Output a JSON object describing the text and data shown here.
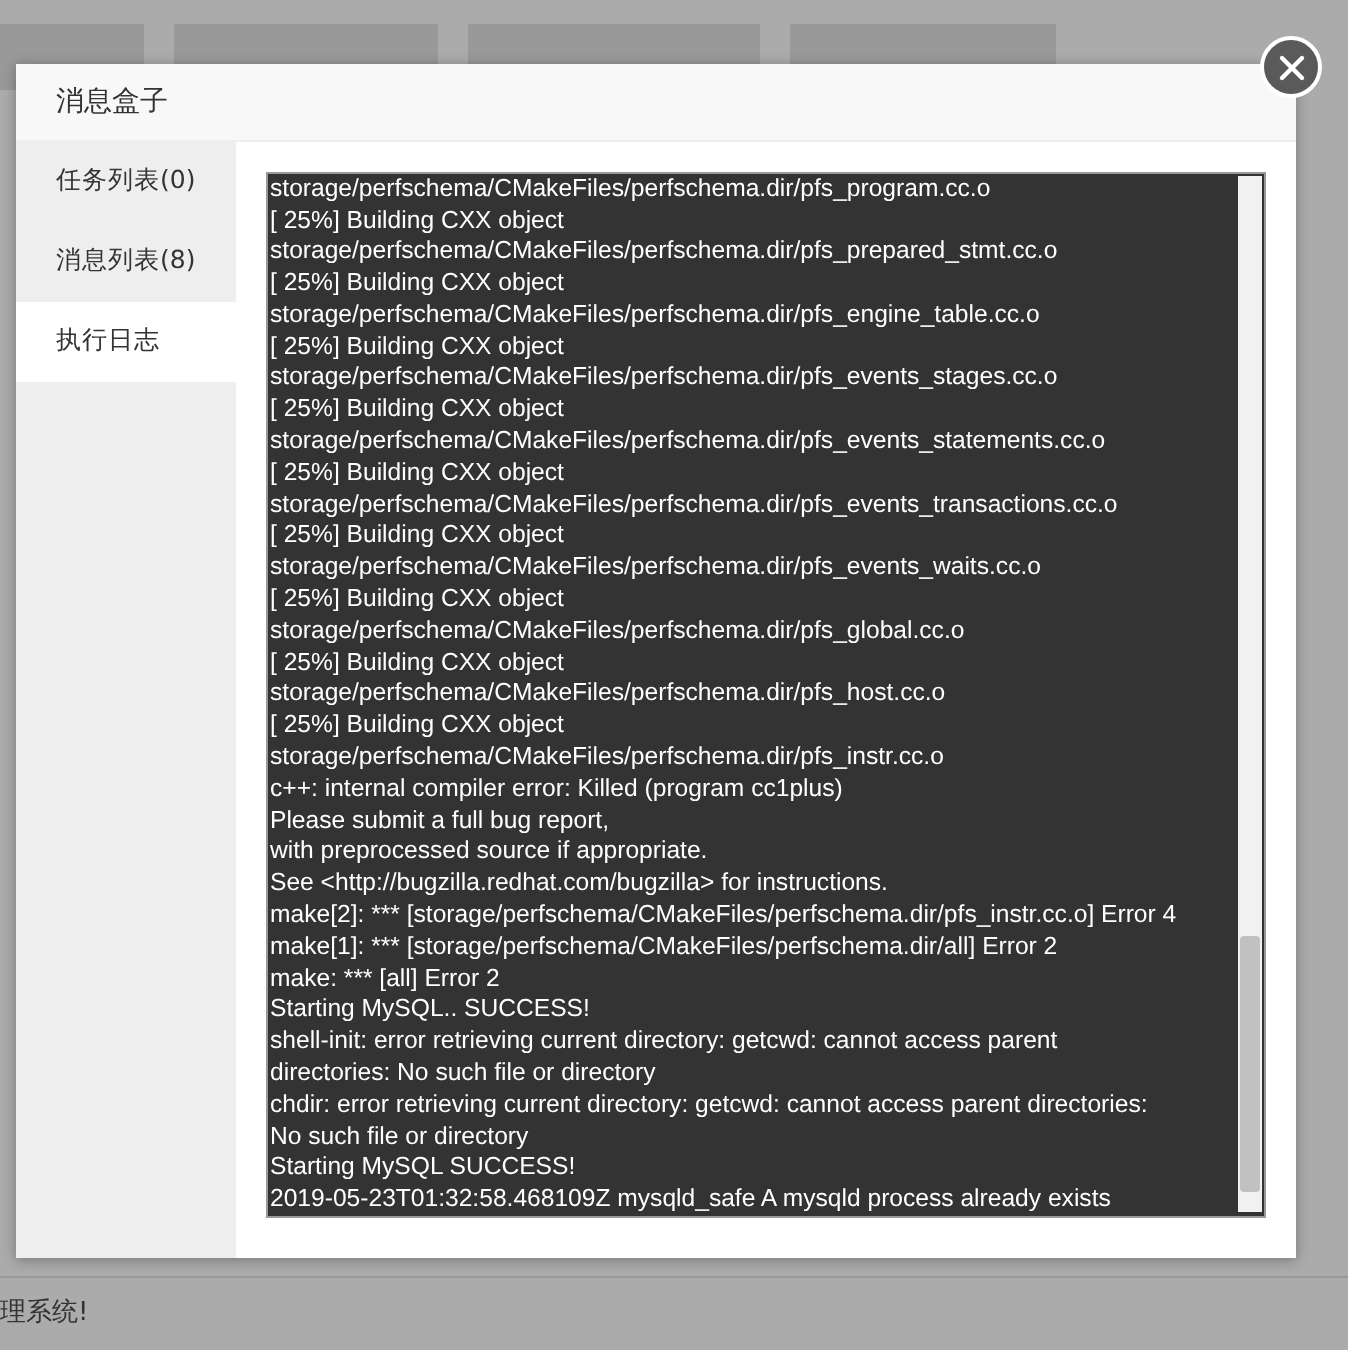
{
  "background_page": {
    "footer_text": "理系统!"
  },
  "dialog": {
    "title": "消息盒子",
    "menu": [
      {
        "label": "任务列表(0)",
        "selected": false
      },
      {
        "label": "消息列表(8)",
        "selected": false
      },
      {
        "label": "执行日志",
        "selected": true
      }
    ],
    "log_lines": [
      "storage/perfschema/CMakeFiles/perfschema.dir/pfs_program.cc.o",
      "[ 25%] Building CXX object",
      "storage/perfschema/CMakeFiles/perfschema.dir/pfs_prepared_stmt.cc.o",
      "[ 25%] Building CXX object",
      "storage/perfschema/CMakeFiles/perfschema.dir/pfs_engine_table.cc.o",
      "[ 25%] Building CXX object",
      "storage/perfschema/CMakeFiles/perfschema.dir/pfs_events_stages.cc.o",
      "[ 25%] Building CXX object",
      "storage/perfschema/CMakeFiles/perfschema.dir/pfs_events_statements.cc.o",
      "[ 25%] Building CXX object",
      "storage/perfschema/CMakeFiles/perfschema.dir/pfs_events_transactions.cc.o",
      "[ 25%] Building CXX object",
      "storage/perfschema/CMakeFiles/perfschema.dir/pfs_events_waits.cc.o",
      "[ 25%] Building CXX object",
      "storage/perfschema/CMakeFiles/perfschema.dir/pfs_global.cc.o",
      "[ 25%] Building CXX object",
      "storage/perfschema/CMakeFiles/perfschema.dir/pfs_host.cc.o",
      "[ 25%] Building CXX object",
      "storage/perfschema/CMakeFiles/perfschema.dir/pfs_instr.cc.o",
      "c++: internal compiler error: Killed (program cc1plus)",
      "Please submit a full bug report,",
      "with preprocessed source if appropriate.",
      "See <http://bugzilla.redhat.com/bugzilla> for instructions.",
      "make[2]: *** [storage/perfschema/CMakeFiles/perfschema.dir/pfs_instr.cc.o] Error 4",
      "make[1]: *** [storage/perfschema/CMakeFiles/perfschema.dir/all] Error 2",
      "make: *** [all] Error 2",
      "Starting MySQL.. SUCCESS!",
      "shell-init: error retrieving current directory: getcwd: cannot access parent",
      "directories: No such file or directory",
      "chdir: error retrieving current directory: getcwd: cannot access parent directories:",
      "No such file or directory",
      "Starting MySQL SUCCESS!",
      "2019-05-23T01:32:58.468109Z mysqld_safe A mysqld process already exists"
    ]
  }
}
